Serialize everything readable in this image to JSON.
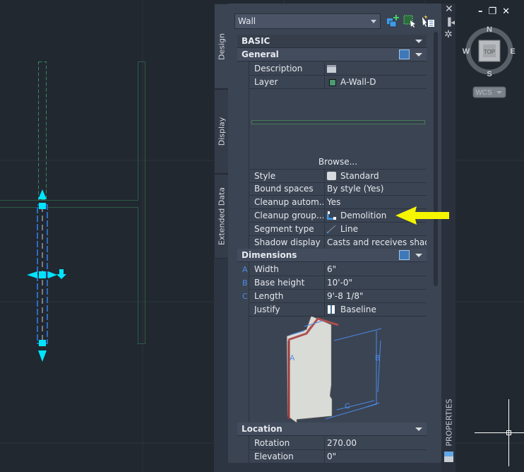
{
  "panel": {
    "object_type": "Wall",
    "tabs": [
      {
        "label": "Design",
        "active": true
      },
      {
        "label": "Display",
        "active": false
      },
      {
        "label": "Extended Data",
        "active": false
      }
    ],
    "toolbar_icons": [
      "add-selection-icon",
      "quick-select-icon",
      "select-objects-icon"
    ],
    "palette_title": "PROPERTIES",
    "sections": {
      "basic": "BASIC",
      "general": {
        "label": "General",
        "rows": [
          {
            "label": "Description",
            "value": "",
            "icon": "description-icon"
          },
          {
            "label": "Layer",
            "value": "A-Wall-D",
            "icon": "layer-color-swatch",
            "color": "#4a9a72"
          }
        ],
        "browse": "Browse...",
        "rows2": [
          {
            "label": "Style",
            "value": "Standard",
            "icon": "wall-style-icon"
          },
          {
            "label": "Bound spaces",
            "value": "By style (Yes)"
          },
          {
            "label": "Cleanup  autom...",
            "value": "Yes"
          },
          {
            "label": "Cleanup  group...",
            "value": "Demolition",
            "icon": "cleanup-group-icon"
          },
          {
            "label": "Segment type",
            "value": "Line",
            "icon": "line-segment-icon"
          },
          {
            "label": "Shadow display",
            "value": "Casts  and  receives  shad..."
          }
        ]
      },
      "dimensions": {
        "label": "Dimensions",
        "rows": [
          {
            "letter": "A",
            "label": "Width",
            "value": "6\""
          },
          {
            "letter": "B",
            "label": "Base height",
            "value": "10'-0\""
          },
          {
            "letter": "C",
            "label": "Length",
            "value": "9'-8 1/8\""
          },
          {
            "letter": "",
            "label": "Justify",
            "value": "Baseline",
            "icon": "justify-icon"
          }
        ],
        "diagram_labels": [
          "A",
          "B",
          "C"
        ]
      },
      "location": {
        "label": "Location",
        "rows": [
          {
            "label": "Rotation",
            "value": "270.00"
          },
          {
            "label": "Elevation",
            "value": "0\""
          }
        ]
      }
    }
  },
  "viewcube": {
    "face": "TOP",
    "north": "N",
    "south": "S",
    "east": "E",
    "west": "W",
    "ucs": "WCS"
  },
  "colors": {
    "accent_arrow": "#f5f500",
    "grip": "#00e5ff",
    "panel_bg": "#3b4453",
    "canvas_bg": "#212830"
  }
}
